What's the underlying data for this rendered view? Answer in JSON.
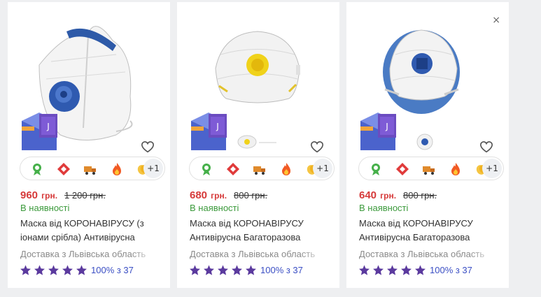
{
  "products": [
    {
      "price": "960",
      "currency": "грн.",
      "old_price": "1 200 грн.",
      "availability": "В наявності",
      "title": "Маска від КОРОНАВІРУСУ (з іонами срібла) Антивірусна",
      "delivery": "Доставка з Львівська область",
      "rating_text": "100% з 37",
      "more_badges": "+1",
      "image": "respirator-mask-blue-valve"
    },
    {
      "price": "680",
      "currency": "грн.",
      "old_price": "800 грн.",
      "availability": "В наявності",
      "title": "Маска від КОРОНАВІРУСУ Антивірусна Багаторазова",
      "delivery": "Доставка з Львівська область",
      "rating_text": "100% з 37",
      "more_badges": "+1",
      "image": "respirator-mask-yellow-valve"
    },
    {
      "price": "640",
      "currency": "грн.",
      "old_price": "800 грн.",
      "availability": "В наявності",
      "title": "Маска від КОРОНАВІРУСУ Антивірусна Багаторазова",
      "delivery": "Доставка з Львівська область",
      "rating_text": "100% з 37",
      "more_badges": "+1",
      "image": "respirator-mask-blue-shell"
    }
  ],
  "close_glyph": "×",
  "badge_icons": [
    "award-icon",
    "nova-poshta-icon",
    "delivery-truck-icon",
    "fire-icon",
    "clapping-hands-icon"
  ],
  "colors": {
    "price": "#d63a3a",
    "available": "#3c9a3c",
    "stars": "#5b3a9e",
    "rating": "#3b4fc4"
  }
}
